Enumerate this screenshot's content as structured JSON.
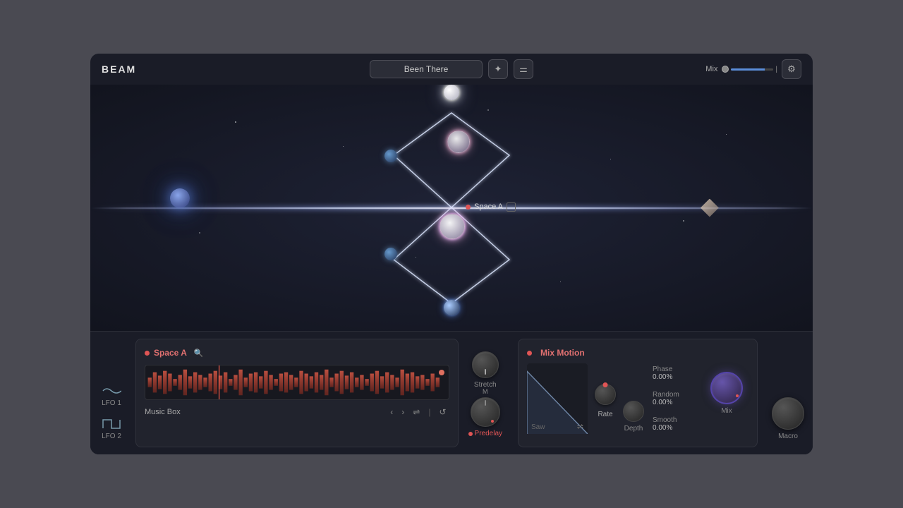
{
  "app": {
    "title": "BEAM"
  },
  "header": {
    "preset_name": "Been There",
    "edit_icon": "✦",
    "filter_icon": "☰",
    "mix_label": "Mix",
    "mix_value": 80,
    "gear_icon": "⚙"
  },
  "viz": {
    "space_a_label": "Space A"
  },
  "lfo": {
    "lfo1_label": "LFO 1",
    "lfo2_label": "LFO 2"
  },
  "space_a_panel": {
    "title": "Space A",
    "sample_name": "Music Box"
  },
  "knobs": {
    "stretch_label": "Stretch",
    "predelay_label": "Predelay"
  },
  "mix_motion": {
    "title": "Mix Motion",
    "saw_label": "Saw",
    "rate_label": "Rate",
    "phase_label": "Phase",
    "phase_value": "0.00%",
    "random_label": "Random",
    "random_value": "0.00%",
    "smooth_label": "Smooth",
    "smooth_value": "0.00%",
    "depth_label": "Depth",
    "mix_label": "Mix"
  },
  "macro": {
    "label": "Macro"
  },
  "colors": {
    "accent_red": "#e05555",
    "accent_blue": "#5b8dd9",
    "accent_purple": "#7755cc"
  }
}
